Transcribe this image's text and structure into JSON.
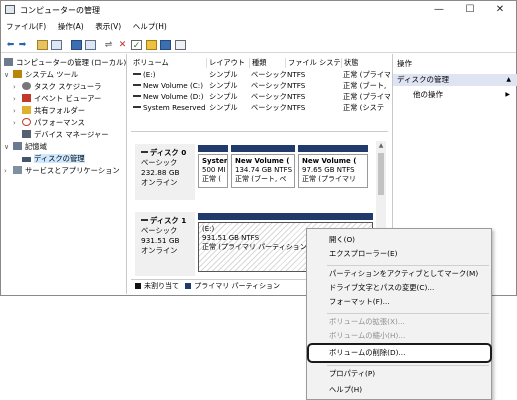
{
  "window": {
    "title": "コンピューターの管理",
    "minimize": "—",
    "maximize": "☐",
    "close": "✕"
  },
  "menu": [
    "ファイル(F)",
    "操作(A)",
    "表示(V)",
    "ヘルプ(H)"
  ],
  "tree": [
    {
      "label": "コンピューターの管理 (ローカル)",
      "toggle": "",
      "icon_color": "#6b7a8f"
    },
    {
      "label": "システム ツール",
      "toggle": "∨",
      "icon_color": "#b8860b"
    },
    {
      "label": "タスク スケジューラ",
      "toggle": "›",
      "icon_color": "#777777"
    },
    {
      "label": "イベント ビューアー",
      "toggle": "›",
      "icon_color": "#c0392b"
    },
    {
      "label": "共有フォルダー",
      "toggle": "›",
      "icon_color": "#e0b030"
    },
    {
      "label": "パフォーマンス",
      "toggle": "›",
      "icon_color": "#c0392b"
    },
    {
      "label": "デバイス マネージャー",
      "toggle": "",
      "icon_color": "#556070"
    },
    {
      "label": "記憶域",
      "toggle": "∨",
      "icon_color": "#6a7a90"
    },
    {
      "label": "ディスクの管理",
      "toggle": "",
      "icon_color": "#44546a",
      "selected": true
    },
    {
      "label": "サービスとアプリケーション",
      "toggle": "›",
      "icon_color": "#8090a0"
    }
  ],
  "volume_table": {
    "headers": [
      "ボリューム",
      "レイアウト",
      "種類",
      "ファイル システム",
      "状態"
    ],
    "rows": [
      [
        "(E:)",
        "シンプル",
        "ベーシック",
        "NTFS",
        "正常 (プライマ"
      ],
      [
        "New Volume (C:)",
        "シンプル",
        "ベーシック",
        "NTFS",
        "正常 (ブート, "
      ],
      [
        "New Volume (D:)",
        "シンプル",
        "ベーシック",
        "NTFS",
        "正常 (プライマ"
      ],
      [
        "System Reserved",
        "シンプル",
        "ベーシック",
        "NTFS",
        "正常 (システ"
      ]
    ]
  },
  "disks": [
    {
      "name": "ディスク 0",
      "type": "ベーシック",
      "size": "232.88 GB",
      "status": "オンライン",
      "partitions": [
        {
          "title": "System",
          "line1": "500 MI",
          "line2": "正常 ("
        },
        {
          "title": "New Volume  (",
          "line1": "134.74 GB NTFS",
          "line2": "正常 (ブート, ペ"
        },
        {
          "title": "New Volume  (",
          "line1": "97.65 GB NTFS",
          "line2": "正常 (プライマリ"
        }
      ]
    },
    {
      "name": "ディスク 1",
      "type": "ベーシック",
      "size": "931.51 GB",
      "status": "オンライン",
      "partitions": [
        {
          "title": "(E:)",
          "line1": "931.51 GB NTFS",
          "line2": "正常 (プライマリ パーティション)"
        }
      ]
    }
  ],
  "legend": [
    {
      "label": "未割り当て",
      "color": "#111111"
    },
    {
      "label": "プライマリ パーティション",
      "color": "#1f3a6b"
    }
  ],
  "actions": {
    "header": "操作",
    "section": "ディスクの管理",
    "item": "他の操作"
  },
  "context_menu": [
    {
      "label": "開く(O)",
      "disabled": false
    },
    {
      "label": "エクスプローラー(E)",
      "disabled": false
    },
    {
      "label": "パーティションをアクティブとしてマーク(M)",
      "disabled": false
    },
    {
      "label": "ドライブ文字とパスの変更(C)...",
      "disabled": false
    },
    {
      "label": "フォーマット(F)...",
      "disabled": false
    },
    {
      "label": "ボリュームの拡張(X)...",
      "disabled": true
    },
    {
      "label": "ボリュームの縮小(H)...",
      "disabled": true
    },
    {
      "label": "ボリュームの削除(D)...",
      "disabled": false,
      "highlighted": true
    },
    {
      "label": "プロパティ(P)",
      "disabled": false
    },
    {
      "label": "ヘルプ(H)",
      "disabled": false
    }
  ]
}
